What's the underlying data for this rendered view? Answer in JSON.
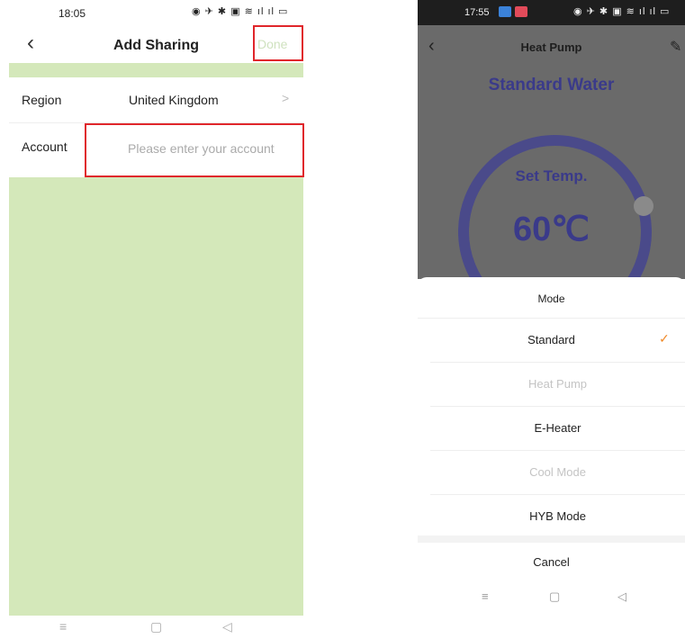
{
  "left": {
    "status": {
      "time": "18:05",
      "icons": "◉ ✈ ✱ ▣ ≋ ıl ıl ▭"
    },
    "header": {
      "back_icon": "‹",
      "title": "Add Sharing",
      "done_label": "Done"
    },
    "region": {
      "label": "Region",
      "value": "United Kingdom",
      "chevron": ">"
    },
    "account": {
      "label": "Account",
      "placeholder": "Please enter your account"
    },
    "nav": {
      "menu": "≡",
      "home": "▢",
      "back": "◁"
    }
  },
  "right": {
    "status": {
      "time": "17:55",
      "icons": "◉ ✈ ✱ ▣ ≋ ıl ıl ▭"
    },
    "header": {
      "back_icon": "‹",
      "title": "Heat Pump",
      "edit_icon": "✎"
    },
    "mode_heading": "Standard Water",
    "dial": {
      "set_label": "Set Temp.",
      "temperature": "60℃"
    },
    "sheet": {
      "title": "Mode",
      "options": [
        {
          "label": "Standard",
          "enabled": true,
          "selected": true
        },
        {
          "label": "Heat Pump",
          "enabled": false,
          "selected": false
        },
        {
          "label": "E-Heater",
          "enabled": true,
          "selected": false
        },
        {
          "label": "Cool Mode",
          "enabled": false,
          "selected": false
        },
        {
          "label": "HYB Mode",
          "enabled": true,
          "selected": false
        }
      ],
      "check_icon": "✓",
      "cancel_label": "Cancel"
    },
    "nav": {
      "menu": "≡",
      "home": "▢",
      "back": "◁"
    }
  },
  "colors": {
    "highlight": "#e0262b",
    "green_bg": "#d4e8ba",
    "accent_check": "#f08a2a",
    "dial_blue": "#3a3a8a"
  }
}
